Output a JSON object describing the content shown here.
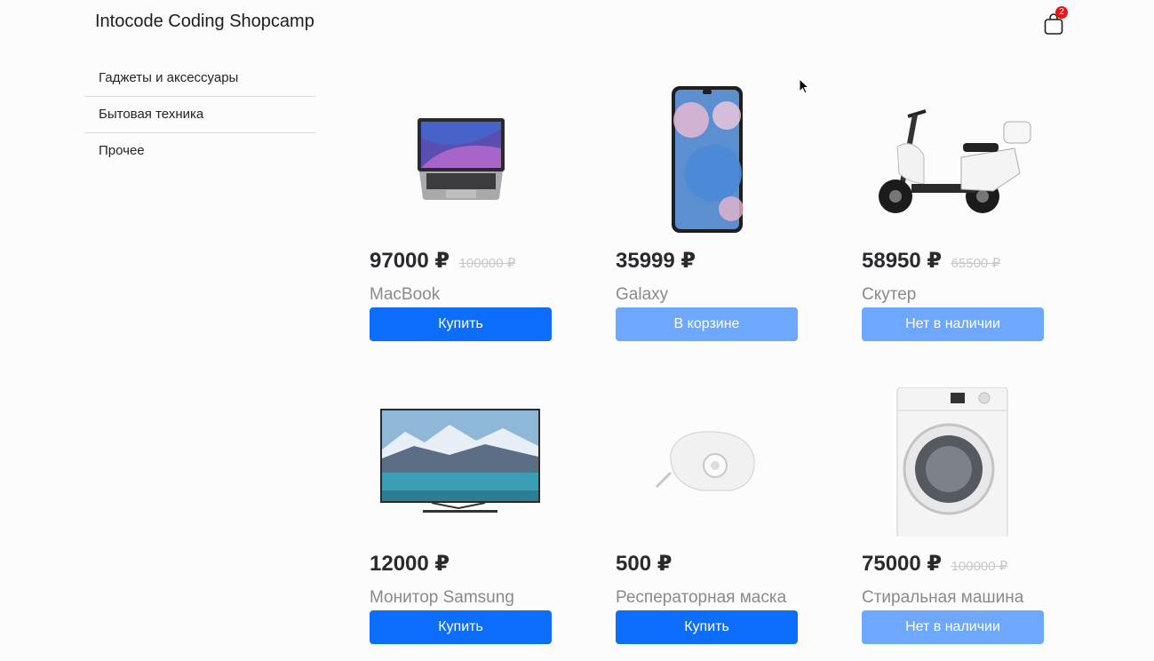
{
  "header": {
    "brand": "Intocode Coding Shopcamp",
    "cart_count": "2",
    "cart_icon": "shopping-bag-icon"
  },
  "sidebar": {
    "items": [
      {
        "label": "Гаджеты и аксессуары"
      },
      {
        "label": "Бытовая техника"
      },
      {
        "label": "Прочее"
      }
    ]
  },
  "products": [
    {
      "price": "97000 ₽",
      "old_price": "100000 ₽",
      "name": "MacBook",
      "button": "Купить",
      "button_state": "active"
    },
    {
      "price": "35999 ₽",
      "old_price": "",
      "name": "Galaxy",
      "button": "В корзине",
      "button_state": "disabled"
    },
    {
      "price": "58950 ₽",
      "old_price": "65500 ₽",
      "name": "Скутер",
      "button": "Нет в наличии",
      "button_state": "disabled"
    },
    {
      "price": "12000 ₽",
      "old_price": "",
      "name": "Монитор Samsung",
      "button": "Купить",
      "button_state": "active"
    },
    {
      "price": "500 ₽",
      "old_price": "",
      "name": "Респераторная маска",
      "button": "Купить",
      "button_state": "active"
    },
    {
      "price": "75000 ₽",
      "old_price": "100000 ₽",
      "name": "Стиральная машина",
      "button": "Нет в наличии",
      "button_state": "disabled"
    }
  ],
  "colors": {
    "primary": "#0d6efd",
    "disabled": "#6ea8fe",
    "badge": "#e8161c"
  }
}
